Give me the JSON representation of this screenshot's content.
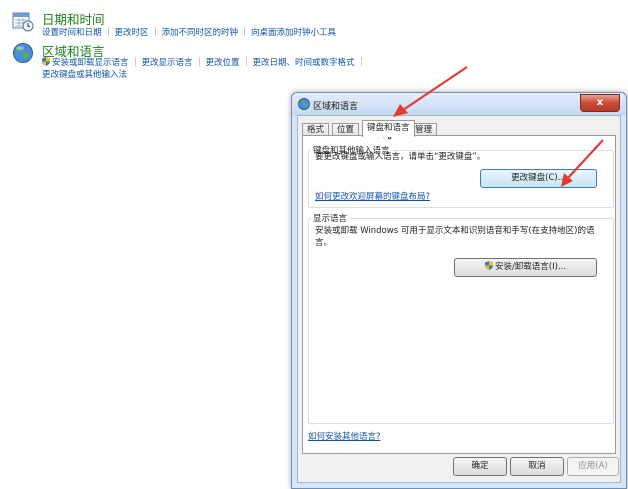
{
  "control_panel": {
    "date_time": {
      "icon": "calendar-clock-icon",
      "title": "日期和时间",
      "links": [
        "设置时间和日期",
        "更改时区",
        "添加不同时区的时钟",
        "向桌面添加时钟小工具"
      ]
    },
    "region_language": {
      "icon": "globe-icon",
      "title": "区域和语言",
      "links": [
        "安装或卸载显示语言",
        "更改显示语言",
        "更改位置",
        "更改日期、时间或数字格式"
      ],
      "link_row2": "更改键盘或其他输入法"
    }
  },
  "dialog": {
    "title": "区域和语言",
    "close_label": "x",
    "tabs": [
      "格式",
      "位置",
      "键盘和语言",
      "管理"
    ],
    "active_tab_index": 2,
    "keyboard_group": {
      "legend": "键盘和其他输入语言",
      "description": "要更改键盘或输入语言，请单击“更改键盘”。",
      "button": "更改键盘(C)...",
      "link": "如何更改欢迎屏幕的键盘布局?"
    },
    "display_group": {
      "legend": "显示语言",
      "description": "安装或卸载 Windows 可用于显示文本和识别语音和手写(在支持地区)的语言。",
      "button": "安装/卸载语言(I)..."
    },
    "bottom_link": "如何安装其他语言?",
    "ok": "确定",
    "cancel": "取消",
    "apply": "应用(A)"
  },
  "colors": {
    "annotation_arrow": "#e33b2e",
    "link": "#1155aa",
    "category_title": "#1e7d1e"
  }
}
